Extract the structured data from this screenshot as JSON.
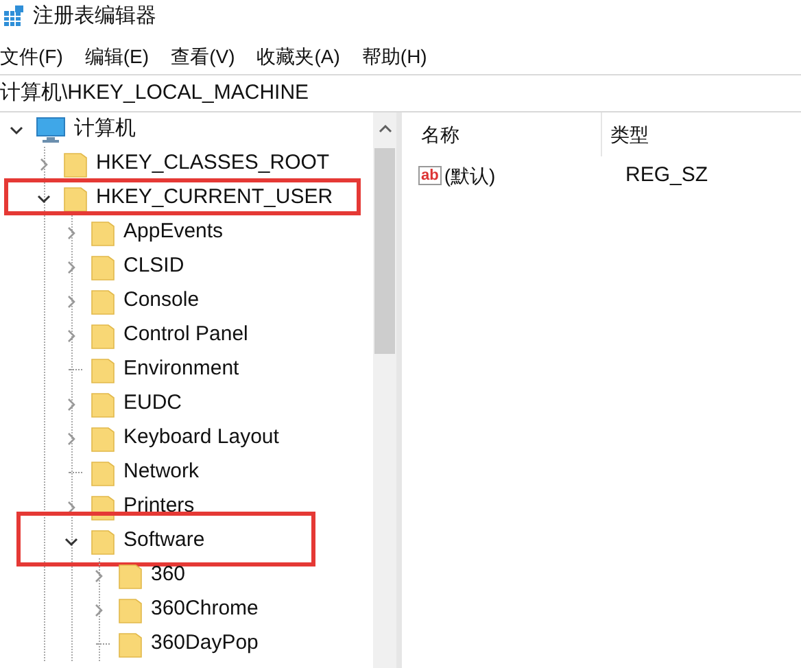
{
  "window": {
    "title": "注册表编辑器"
  },
  "menu": [
    {
      "label": "文件(F)"
    },
    {
      "label": "编辑(E)"
    },
    {
      "label": "查看(V)"
    },
    {
      "label": "收藏夹(A)"
    },
    {
      "label": "帮助(H)"
    }
  ],
  "address": "计算机\\HKEY_LOCAL_MACHINE",
  "tree": [
    {
      "label": "计算机",
      "kind": "computer",
      "expandable": true,
      "expanded": true,
      "highlighted": false,
      "children": [
        {
          "label": "HKEY_CLASSES_ROOT",
          "kind": "folder",
          "expandable": true,
          "expanded": false,
          "highlighted": false
        },
        {
          "label": "HKEY_CURRENT_USER",
          "kind": "folder",
          "expandable": true,
          "expanded": true,
          "highlighted": true,
          "children": [
            {
              "label": "AppEvents",
              "kind": "folder",
              "expandable": true,
              "expanded": false,
              "highlighted": false
            },
            {
              "label": "CLSID",
              "kind": "folder",
              "expandable": true,
              "expanded": false,
              "highlighted": false
            },
            {
              "label": "Console",
              "kind": "folder",
              "expandable": true,
              "expanded": false,
              "highlighted": false
            },
            {
              "label": "Control Panel",
              "kind": "folder",
              "expandable": true,
              "expanded": false,
              "highlighted": false
            },
            {
              "label": "Environment",
              "kind": "folder",
              "expandable": false,
              "highlighted": false
            },
            {
              "label": "EUDC",
              "kind": "folder",
              "expandable": true,
              "expanded": false,
              "highlighted": false
            },
            {
              "label": "Keyboard Layout",
              "kind": "folder",
              "expandable": true,
              "expanded": false,
              "highlighted": false
            },
            {
              "label": "Network",
              "kind": "folder",
              "expandable": false,
              "highlighted": false
            },
            {
              "label": "Printers",
              "kind": "folder",
              "expandable": true,
              "expanded": false,
              "highlighted": false
            },
            {
              "label": "Software",
              "kind": "folder",
              "expandable": true,
              "expanded": true,
              "highlighted": true,
              "children": [
                {
                  "label": "360",
                  "kind": "folder",
                  "expandable": true,
                  "expanded": false,
                  "highlighted": false
                },
                {
                  "label": "360Chrome",
                  "kind": "folder",
                  "expandable": true,
                  "expanded": false,
                  "highlighted": false
                },
                {
                  "label": "360DayPop",
                  "kind": "folder",
                  "expandable": false,
                  "highlighted": false
                }
              ]
            }
          ]
        }
      ]
    }
  ],
  "values": {
    "columns": [
      "名称",
      "类型"
    ],
    "rows": [
      {
        "icon_text": "ab",
        "name": "(默认)",
        "type": "REG_SZ"
      }
    ]
  }
}
